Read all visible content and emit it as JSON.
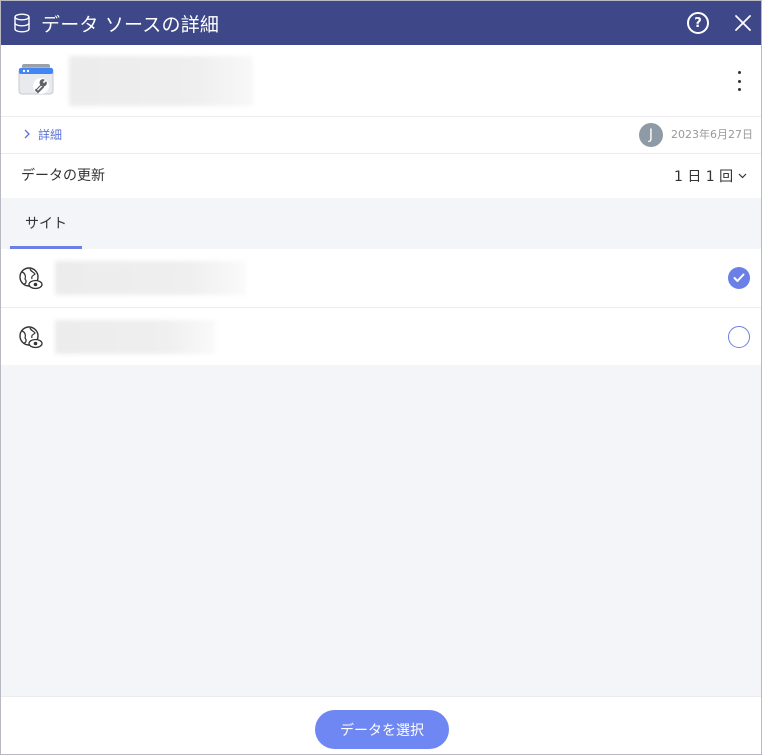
{
  "window": {
    "title": "データ ソースの詳細",
    "help_label": "?"
  },
  "source": {
    "details_label": "詳細",
    "owner_initial": "J",
    "updated_date": "2023年6月27日"
  },
  "refresh": {
    "label": "データの更新",
    "value": "1 日 1 回"
  },
  "tabs": [
    {
      "label": "サイト",
      "active": true
    }
  ],
  "sites": [
    {
      "selected": true
    },
    {
      "selected": false
    }
  ],
  "footer": {
    "select_label": "データを選択"
  },
  "colors": {
    "titlebar": "#3e4787",
    "accent": "#6a80e6",
    "button": "#6f87f2"
  },
  "icons": {
    "title": "database-icon",
    "source": "search-console-icon",
    "site": "globe-eye-icon"
  }
}
